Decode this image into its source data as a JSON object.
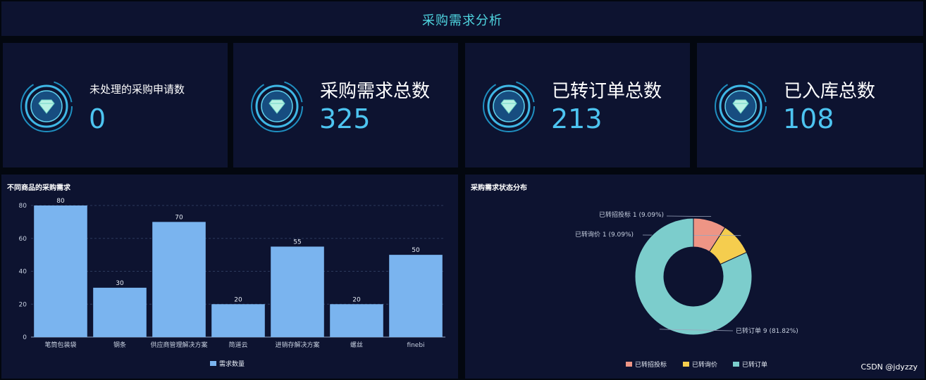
{
  "header": {
    "title": "采购需求分析"
  },
  "kpis": [
    {
      "label": "未处理的采购申请数",
      "value": "0"
    },
    {
      "label": "采购需求总数",
      "value": "325"
    },
    {
      "label": "已转订单总数",
      "value": "213"
    },
    {
      "label": "已入库总数",
      "value": "108"
    }
  ],
  "icons": {
    "kpi_icon": "diamond-icon"
  },
  "colors": {
    "bar": "#7ab4ef",
    "accent": "#4fd5e0",
    "kpi_value": "#4dc4f0"
  },
  "bar_chart_title": "不同商品的采购需求",
  "pie_chart_title": "采购需求状态分布",
  "chart_data": [
    {
      "type": "bar",
      "title": "不同商品的采购需求",
      "categories": [
        "笔筒包装袋",
        "钢条",
        "供应商管理解决方案",
        "简道云",
        "进销存解决方案",
        "螺丝",
        "finebi"
      ],
      "series": [
        {
          "name": "需求数量",
          "values": [
            80,
            30,
            70,
            20,
            55,
            20,
            50
          ]
        }
      ],
      "ylim": [
        0,
        80
      ],
      "yticks": [
        0,
        20,
        40,
        60,
        80
      ],
      "grid": true,
      "legend": "bottom-center",
      "color": "#7ab4ef"
    },
    {
      "type": "pie",
      "title": "采购需求状态分布",
      "donut": true,
      "slices": [
        {
          "name": "已转招投标",
          "value": 1,
          "label": "已转招投标 1 (9.09%)",
          "color": "#ee9585"
        },
        {
          "name": "已转询价",
          "value": 1,
          "label": "已转询价 1 (9.09%)",
          "color": "#f5cd4e"
        },
        {
          "name": "已转订单",
          "value": 9,
          "label": "已转订单 9 (81.82%)",
          "color": "#7ccdcc"
        }
      ],
      "legend": "bottom-center"
    }
  ],
  "watermark": "CSDN @jdyzzy"
}
